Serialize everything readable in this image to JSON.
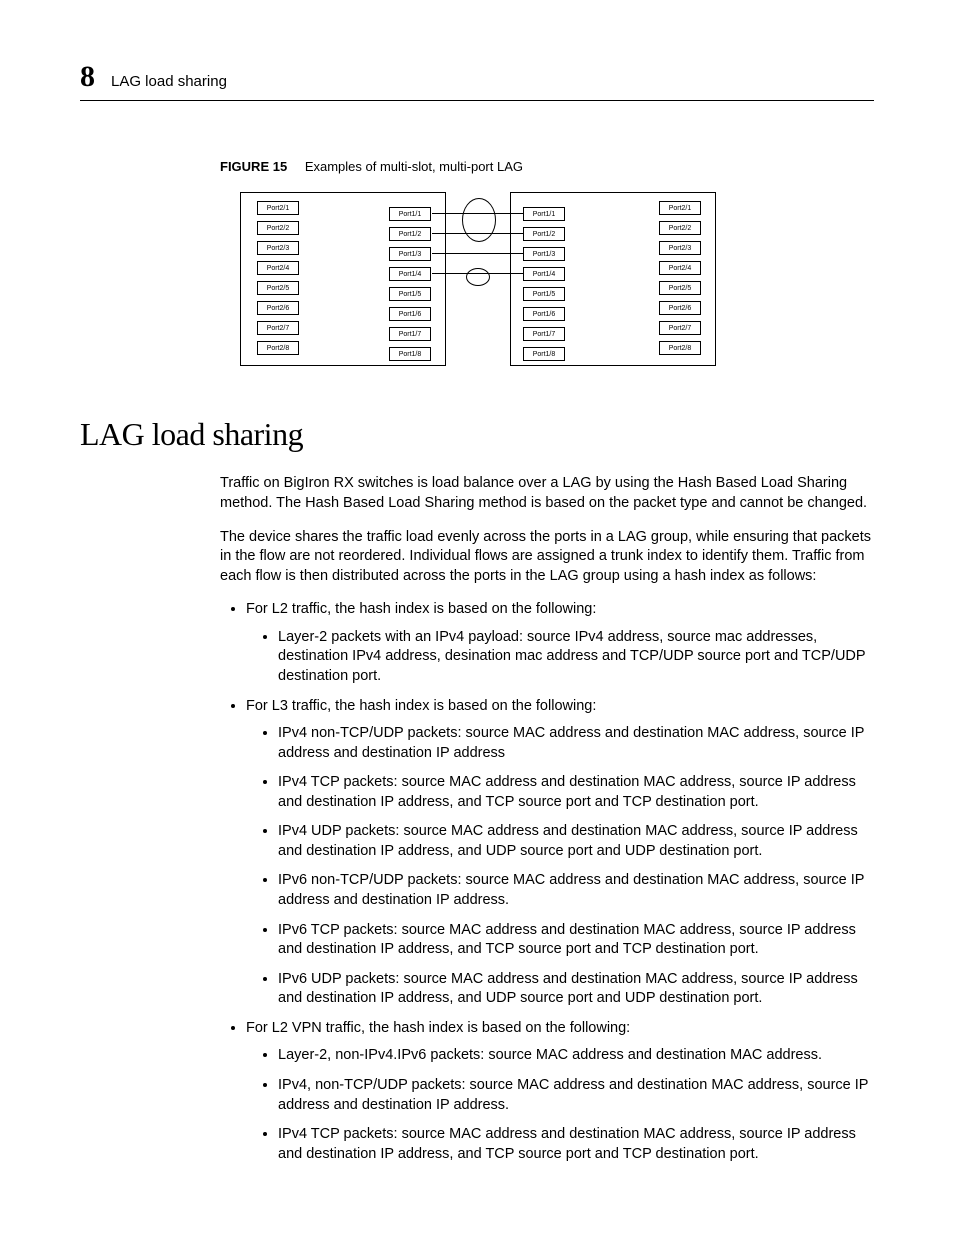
{
  "header": {
    "chapter_number": "8",
    "running_title": "LAG load sharing"
  },
  "figure": {
    "label": "FIGURE 15",
    "caption": "Examples of multi-slot, multi-port LAG",
    "left_switch": {
      "outer_ports": [
        "Port2/1",
        "Port2/2",
        "Port2/3",
        "Port2/4",
        "Port2/5",
        "Port2/6",
        "Port2/7",
        "Port2/8"
      ],
      "inner_ports": [
        "Port1/1",
        "Port1/2",
        "Port1/3",
        "Port1/4",
        "Port1/5",
        "Port1/6",
        "Port1/7",
        "Port1/8"
      ]
    },
    "right_switch": {
      "inner_ports": [
        "Port1/1",
        "Port1/2",
        "Port1/3",
        "Port1/4",
        "Port1/5",
        "Port1/6",
        "Port1/7",
        "Port1/8"
      ],
      "outer_ports": [
        "Port2/1",
        "Port2/2",
        "Port2/3",
        "Port2/4",
        "Port2/5",
        "Port2/6",
        "Port2/7",
        "Port2/8"
      ]
    }
  },
  "section": {
    "heading": "LAG load sharing",
    "para1": "Traffic on BigIron RX switches is load balance over a LAG by using the Hash Based Load Sharing method. The Hash Based Load Sharing method is based on the packet type and cannot be changed.",
    "para2": "The device shares the traffic load evenly across the ports in a LAG group, while ensuring that packets in the flow are not reordered. Individual flows are assigned a trunk index to identify them. Traffic from each flow is then distributed across the ports in the LAG group using a hash index as follows:",
    "bullets": [
      {
        "text": "For L2 traffic, the hash index is based on the following:",
        "children": [
          "Layer-2 packets with an IPv4 payload: source IPv4 address, source mac addresses, destination IPv4 address,  desination mac address and TCP/UDP source port and TCP/UDP destination port."
        ]
      },
      {
        "text": "For L3 traffic, the hash index is based on the following:",
        "children": [
          "IPv4 non-TCP/UDP packets: source MAC address and destination MAC address, source IP address and destination IP address",
          "IPv4 TCP packets: source MAC address and destination MAC address, source IP address and destination IP address, and TCP source port and TCP destination port.",
          "IPv4 UDP packets: source MAC address and destination MAC address, source IP address and destination IP address, and UDP source port and UDP destination port.",
          "IPv6 non-TCP/UDP packets: source MAC address and destination MAC address, source IP address and destination IP address.",
          "IPv6 TCP packets: source MAC address and destination MAC address, source IP address and destination IP address, and TCP source port and TCP destination port.",
          "IPv6 UDP packets: source MAC address and destination MAC address, source IP address and destination IP address, and UDP source port and UDP destination port."
        ]
      },
      {
        "text": "For L2 VPN traffic, the hash index is based on the following:",
        "children": [
          "Layer-2, non-IPv4.IPv6 packets: source MAC address and destination MAC address.",
          "IPv4, non-TCP/UDP packets: source MAC address and destination MAC address, source IP address and destination IP address.",
          "IPv4 TCP packets: source MAC address and destination MAC address, source IP address and destination IP address,  and TCP source port and TCP destination port."
        ]
      }
    ]
  }
}
